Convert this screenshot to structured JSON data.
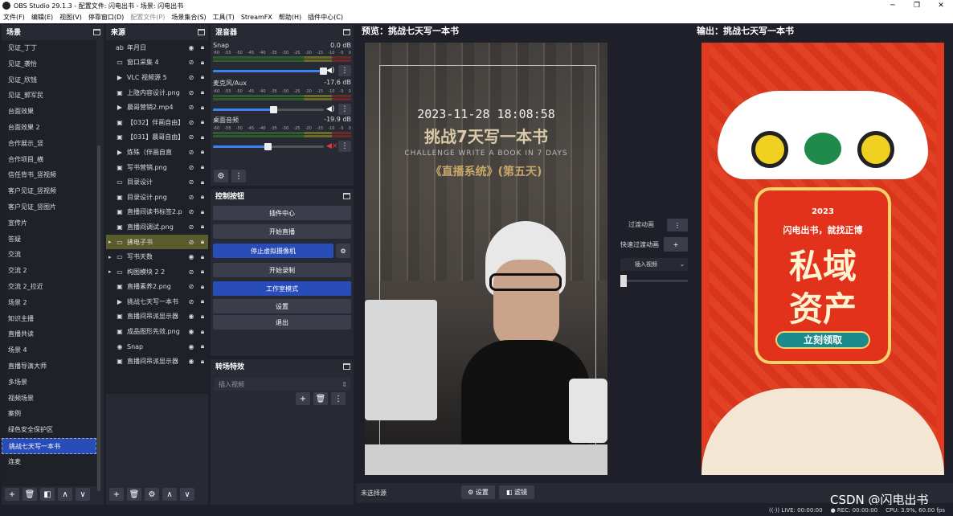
{
  "window": {
    "title": "OBS Studio 29.1.3 - 配置文件: 闪电出书 - 场景: 闪电出书"
  },
  "menu": [
    {
      "label": "文件(F)",
      "dim": false
    },
    {
      "label": "编辑(E)",
      "dim": false
    },
    {
      "label": "视图(V)",
      "dim": false
    },
    {
      "label": "停靠窗口(D)",
      "dim": false
    },
    {
      "label": "配置文件(P)",
      "dim": true
    },
    {
      "label": "场景集合(S)",
      "dim": false
    },
    {
      "label": "工具(T)",
      "dim": false
    },
    {
      "label": "StreamFX",
      "dim": false
    },
    {
      "label": "帮助(H)",
      "dim": false
    },
    {
      "label": "插件中心(C)",
      "dim": false
    }
  ],
  "scenes": {
    "title": "场景",
    "items": [
      "见证_丁丁",
      "见证_袭怡",
      "见证_欣钱",
      "见证_郭军民",
      "台面效果",
      "台面效果 2",
      "合作展示_竖",
      "合作项目_横",
      "信任背书_竖视频",
      "客户见证_竖视频",
      "客户见证_竖图片",
      "宣传片",
      "答疑",
      "交流",
      "交流 2",
      "交流 2_拉近",
      "场景 2",
      "知识主播",
      "直播共读",
      "场景 4",
      "直播导演大师",
      "多场景",
      "视频场景",
      "案例",
      "绿色安全保护区",
      "挑战七天写一本书",
      "连麦"
    ],
    "selected_index": 25
  },
  "sources": {
    "title": "来源",
    "items": [
      {
        "icon": "ab",
        "name": "年月日",
        "expand": false,
        "visible": true
      },
      {
        "icon": "▭",
        "name": "窗口采集 4",
        "expand": false,
        "visible": false
      },
      {
        "icon": "▶",
        "name": "VLC 视频源 5",
        "expand": false,
        "visible": false
      },
      {
        "icon": "▣",
        "name": "上隐内容设计.png",
        "expand": false,
        "visible": false
      },
      {
        "icon": "▶",
        "name": "晨哥营销2.mp4",
        "expand": false,
        "visible": false
      },
      {
        "icon": "▣",
        "name": "【032】伴画自由】",
        "expand": false,
        "visible": false
      },
      {
        "icon": "▣",
        "name": "【031】晨哥自由】",
        "expand": false,
        "visible": false
      },
      {
        "icon": "▶",
        "name": "炼殊（伴画自直",
        "expand": false,
        "visible": false
      },
      {
        "icon": "▣",
        "name": "写书营销.png",
        "expand": false,
        "visible": false
      },
      {
        "icon": "▭",
        "name": "目录设计",
        "expand": false,
        "visible": false
      },
      {
        "icon": "▣",
        "name": "目录设计.png",
        "expand": false,
        "visible": false
      },
      {
        "icon": "▣",
        "name": "直播间读书标签2.p",
        "expand": false,
        "visible": false
      },
      {
        "icon": "▣",
        "name": "直播间调试.png",
        "expand": false,
        "visible": false
      },
      {
        "icon": "▭",
        "name": "拂电子书",
        "expand": true,
        "visible": false
      },
      {
        "icon": "▭",
        "name": "写书天数",
        "expand": true,
        "visible": true
      },
      {
        "icon": "▭",
        "name": "构图模块 2 2",
        "expand": true,
        "visible": false
      },
      {
        "icon": "▣",
        "name": "直播素养2.png",
        "expand": false,
        "visible": false
      },
      {
        "icon": "▶",
        "name": "挑战七天写一本书",
        "expand": false,
        "visible": false
      },
      {
        "icon": "▣",
        "name": "直播间吊派显示器",
        "expand": false,
        "visible": true
      },
      {
        "icon": "▣",
        "name": "成品图形先效.png",
        "expand": false,
        "visible": true
      },
      {
        "icon": "◉",
        "name": "Snap",
        "expand": false,
        "visible": true
      },
      {
        "icon": "▣",
        "name": "直播间吊派显示器",
        "expand": false,
        "visible": true
      }
    ],
    "selected_index": 13
  },
  "mixer": {
    "title": "混音器",
    "scale": [
      "-60",
      "-55",
      "-50",
      "-45",
      "-40",
      "-35",
      "-30",
      "-25",
      "-20",
      "-15",
      "-10",
      "-5",
      "0"
    ],
    "tracks": [
      {
        "name": "Snap",
        "db": "0.0 dB",
        "volume": 1.0,
        "meter": 0.0,
        "muted": false
      },
      {
        "name": "麦克风/Aux",
        "db": "-17.6 dB",
        "volume": 0.55,
        "meter": 0.0,
        "muted": false
      },
      {
        "name": "桌面音频",
        "db": "-19.9 dB",
        "volume": 0.5,
        "meter": 0.0,
        "muted": true
      }
    ]
  },
  "controls": {
    "title": "控制按钮",
    "buttons": [
      "插件中心",
      "开始直播",
      "停止虚拟摄像机",
      "开始录制",
      "工作室模式",
      "设置",
      "退出"
    ]
  },
  "transitions": {
    "title": "转场特效",
    "selected": "插入视频"
  },
  "studio": {
    "preview_label": "预览：挑战七天写一本书",
    "program_label": "输出：挑战七天写一本书",
    "transition_btn": "过渡动画",
    "quick_transition": "快速过渡动画",
    "transition_select": "插入视频",
    "no_source": "未选择源",
    "settings_btn": "设置",
    "filters_btn": "滤镜"
  },
  "preview_overlay": {
    "datetime": "2023-11-28 18:08:58",
    "headline": "挑战7天写一本书",
    "subtitle": "CHALLENGE WRITE A BOOK IN 7 DAYS",
    "series": "《直播系统》(第五天)"
  },
  "program_overlay": {
    "year": "2023",
    "tagline": "闪电出书，就找正博",
    "big1": "私域",
    "big2": "资产",
    "cta": "立刻领取"
  },
  "status": {
    "live": "LIVE: 00:00:00",
    "rec": "REC: 00:00:00",
    "cpu": "CPU: 3.9%, 60.00 fps"
  },
  "watermark": "CSDN @闪电出书"
}
